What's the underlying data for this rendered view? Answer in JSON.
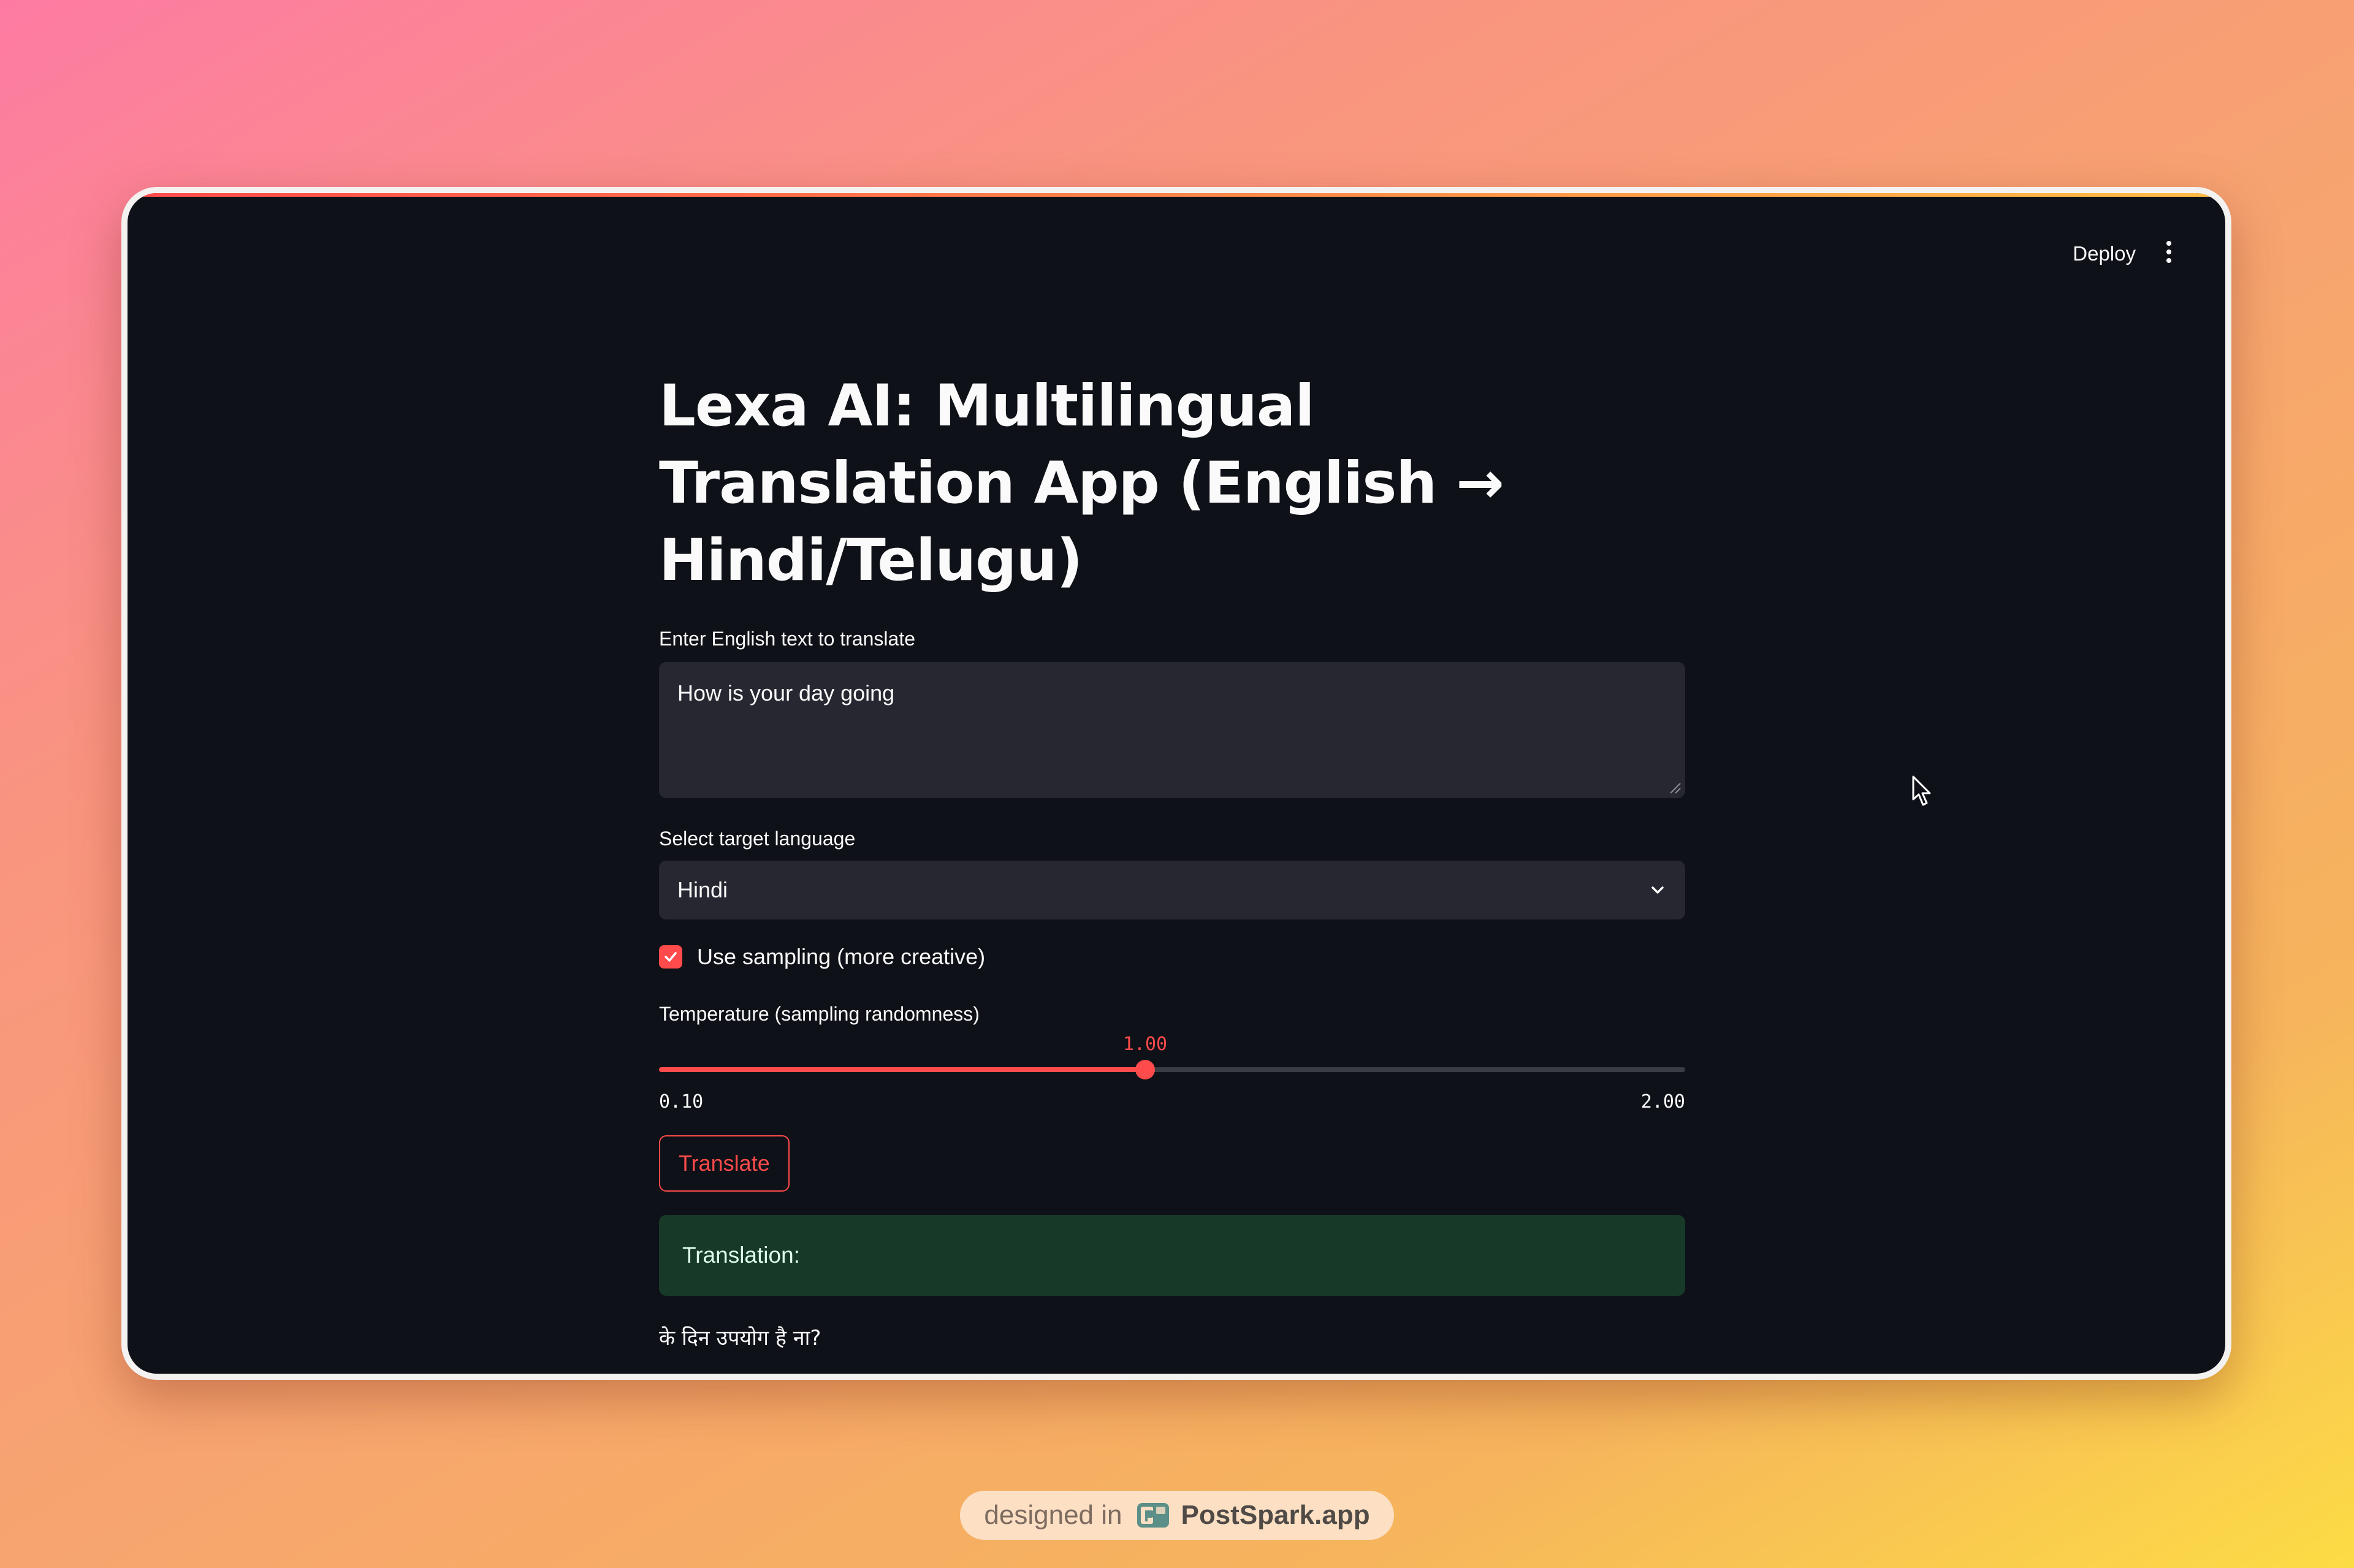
{
  "header": {
    "deploy_label": "Deploy"
  },
  "main": {
    "title": "Lexa AI: Multilingual Translation App (English → Hindi/Telugu)",
    "input": {
      "label": "Enter English text to translate",
      "value": "How is your day going"
    },
    "language": {
      "label": "Select target language",
      "selected": "Hindi"
    },
    "sampling": {
      "label": "Use sampling (more creative)",
      "checked": true
    },
    "temperature": {
      "label": "Temperature (sampling randomness)",
      "value": 1.0,
      "value_label": "1.00",
      "min": 0.1,
      "max": 2.0,
      "min_label": "0.10",
      "max_label": "2.00"
    },
    "translate_button": "Translate",
    "result_label": "Translation:",
    "result_text": "के दिन उपयोग है ना?"
  },
  "watermark": {
    "prefix": "designed in",
    "brand": "PostSpark.app"
  },
  "colors": {
    "accent": "#ff4b4b",
    "app_background": "#0e1117",
    "input_background": "#262730",
    "success_background": "#173928"
  },
  "icons": {
    "menu": "vertical-dots-icon",
    "dropdown": "chevron-down-icon",
    "checkbox": "checkmark-icon",
    "cursor": "mouse-pointer-icon",
    "brand": "postspark-logo-icon"
  }
}
